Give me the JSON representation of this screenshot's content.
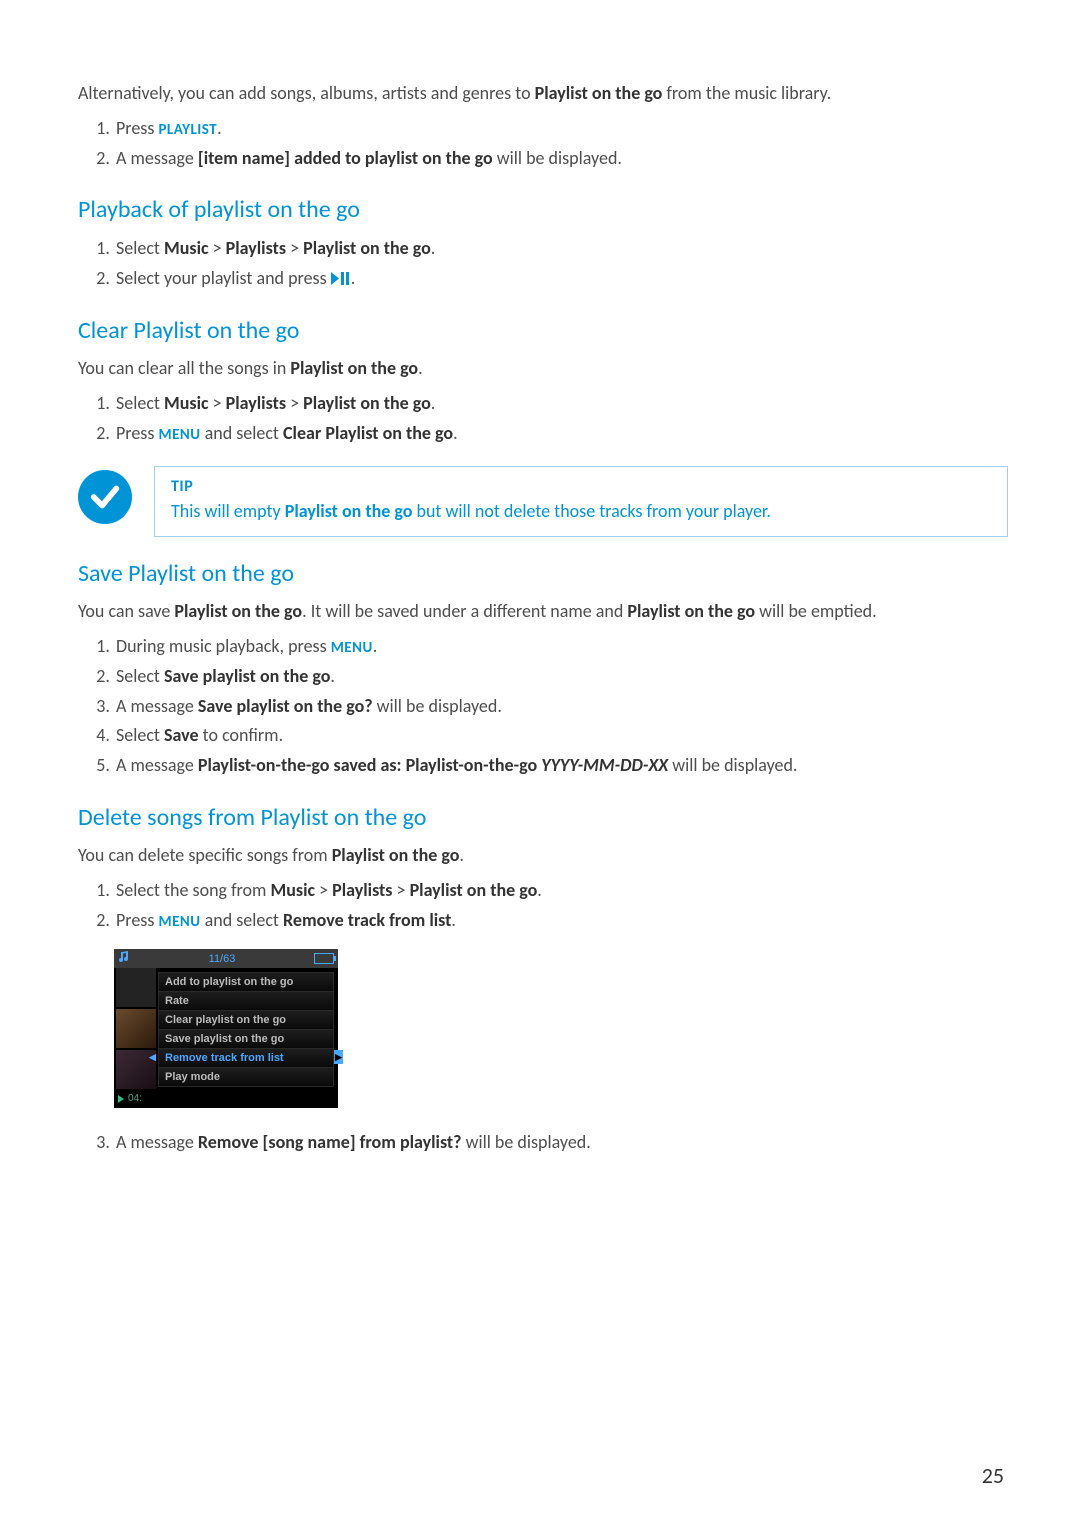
{
  "intro": {
    "pre": "Alternatively, you can add songs, albums, artists and genres to ",
    "bold": "Playlist on the go",
    "post": " from the music library."
  },
  "intro_steps": {
    "s1_pre": "Press ",
    "s1_label": "PLAYLIST",
    "s1_post": ".",
    "s2_pre": "A message ",
    "s2_bold": "[item name] added to playlist on the go",
    "s2_post": " will be displayed."
  },
  "playback": {
    "heading": "Playback of playlist on the go",
    "s1_pre": "Select ",
    "s1_b1": "Music",
    "s1_gt1": " > ",
    "s1_b2": "Playlists",
    "s1_gt2": " > ",
    "s1_b3": "Playlist on the go",
    "s1_post": ".",
    "s2_pre": "Select your playlist and press ",
    "s2_post": "."
  },
  "clear": {
    "heading": "Clear Playlist on the go",
    "intro_pre": "You can clear all the songs in ",
    "intro_bold": "Playlist on the go",
    "intro_post": ".",
    "s1_pre": "Select ",
    "s1_b1": "Music",
    "s1_gt1": " > ",
    "s1_b2": "Playlists",
    "s1_gt2": " > ",
    "s1_b3": "Playlist on the go",
    "s1_post": ".",
    "s2_pre": "Press ",
    "s2_label": "MENU",
    "s2_mid": " and select ",
    "s2_bold": "Clear Playlist on the go",
    "s2_post": "."
  },
  "tip": {
    "title": "TIP",
    "pre": "This will empty ",
    "bold": "Playlist on the go",
    "post": " but will not delete those tracks from your player."
  },
  "save": {
    "heading": "Save Playlist on the go",
    "intro_pre": "You can save ",
    "intro_bold1": "Playlist on the go",
    "intro_mid": ". It will be saved under a different name and ",
    "intro_bold2": "Playlist on the go",
    "intro_post": " will be emptied.",
    "s1_pre": "During music playback, press ",
    "s1_label": "MENU",
    "s1_post": ".",
    "s2_pre": "Select ",
    "s2_bold": "Save playlist on the go",
    "s2_post": ".",
    "s3_pre": "A message ",
    "s3_bold": "Save playlist on the go?",
    "s3_post": " will be displayed.",
    "s4_pre": "Select ",
    "s4_bold": "Save",
    "s4_post": " to confirm.",
    "s5_pre": "A message ",
    "s5_bold": "Playlist-on-the-go saved as: Playlist-on-the-go",
    "s5_italic": " YYYY-MM-DD-XX",
    "s5_post": " will be displayed."
  },
  "delete": {
    "heading": "Delete songs from Playlist on the go",
    "intro_pre": "You can delete specific songs from ",
    "intro_bold": "Playlist on the go",
    "intro_post": ".",
    "s1_pre": "Select the song from ",
    "s1_b1": "Music",
    "s1_gt1": " > ",
    "s1_b2": "Playlists",
    "s1_gt2": " > ",
    "s1_b3": "Playlist on the go",
    "s1_post": ".",
    "s2_pre": "Press ",
    "s2_label": "MENU",
    "s2_mid": " and select ",
    "s2_bold": "Remove track from list",
    "s2_post": ".",
    "s3_pre": "A message ",
    "s3_bold": "Remove [song name] from playlist?",
    "s3_post": " will be displayed."
  },
  "device": {
    "counter": "11/63",
    "items": [
      "Add to playlist on the go",
      "Rate",
      "Clear playlist on the go",
      "Save playlist on the go",
      "Remove track from list",
      "Play mode"
    ],
    "selected_index": 4,
    "time": "04:"
  },
  "page_number": "25"
}
